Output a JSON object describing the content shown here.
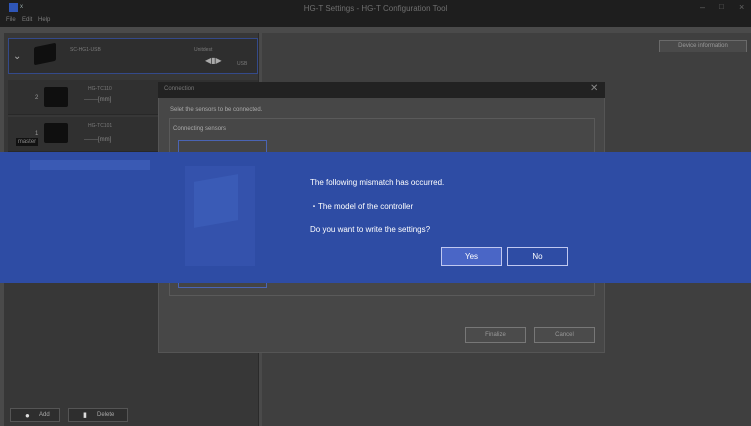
{
  "window": {
    "title": "HG-T Settings - HG-T Configuration Tool",
    "icon_suffix": "x",
    "minimize_icon": "minimize-icon",
    "maximize_icon": "maximize-icon",
    "close_icon": "close-icon"
  },
  "menu": {
    "items": [
      "File",
      "Edit",
      "Help"
    ]
  },
  "left_panel": {
    "controller": {
      "model": "SC-HG1-USB",
      "status": "Unitdest",
      "port": "USB",
      "icon": "usb-plug-icon"
    },
    "sensors": [
      {
        "index": "2",
        "model": "HG-TC110",
        "value": "-------[mm]"
      },
      {
        "index": "1",
        "model": "HG-TC101",
        "value": "-------[mm]",
        "badge": "master"
      }
    ],
    "add_label": "Add",
    "delete_label": "Delete"
  },
  "right_panel": {
    "tab_label": "Device information"
  },
  "connection_dialog": {
    "title": "Connection",
    "instruction": "Selet the sensors to be connected.",
    "group_label": "Connecting sensors",
    "finalize_label": "Finalize",
    "cancel_label": "Cancel"
  },
  "mismatch": {
    "line1": "The following mismatch has occurred.",
    "line2": "・The model of the controller",
    "line3": "Do you want to write the settings?",
    "yes_label": "Yes",
    "no_label": "No",
    "background": "#2e4ca4"
  }
}
